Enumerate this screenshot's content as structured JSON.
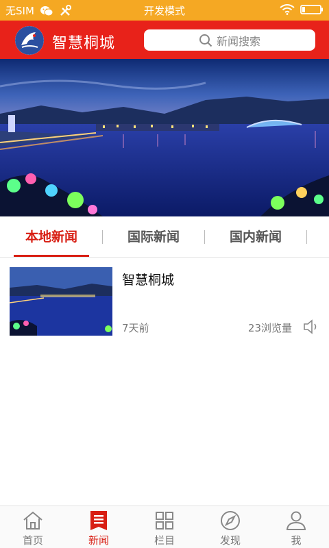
{
  "status_bar": {
    "carrier": "无SIM",
    "mode": "开发模式",
    "icons": [
      "wechat-icon",
      "tools-icon",
      "wifi-icon",
      "battery-icon"
    ]
  },
  "header": {
    "title": "智慧桐城",
    "search_placeholder": "新闻搜索",
    "bg_color": "#e8221a"
  },
  "tabs": [
    {
      "label": "本地新闻",
      "active": true
    },
    {
      "label": "国际新闻",
      "active": false
    },
    {
      "label": "国内新闻",
      "active": false
    }
  ],
  "news": [
    {
      "title": "智慧桐城",
      "time": "7天前",
      "views": "23浏览量",
      "icon": "speaker-icon"
    }
  ],
  "bottom_nav": [
    {
      "label": "首页",
      "icon": "home-icon",
      "active": false
    },
    {
      "label": "新闻",
      "icon": "news-icon",
      "active": true
    },
    {
      "label": "栏目",
      "icon": "grid-icon",
      "active": false
    },
    {
      "label": "发现",
      "icon": "compass-icon",
      "active": false
    },
    {
      "label": "我",
      "icon": "user-icon",
      "active": false
    }
  ],
  "colors": {
    "status_bar": "#f5a823",
    "accent": "#d81e13",
    "header": "#e8221a"
  }
}
